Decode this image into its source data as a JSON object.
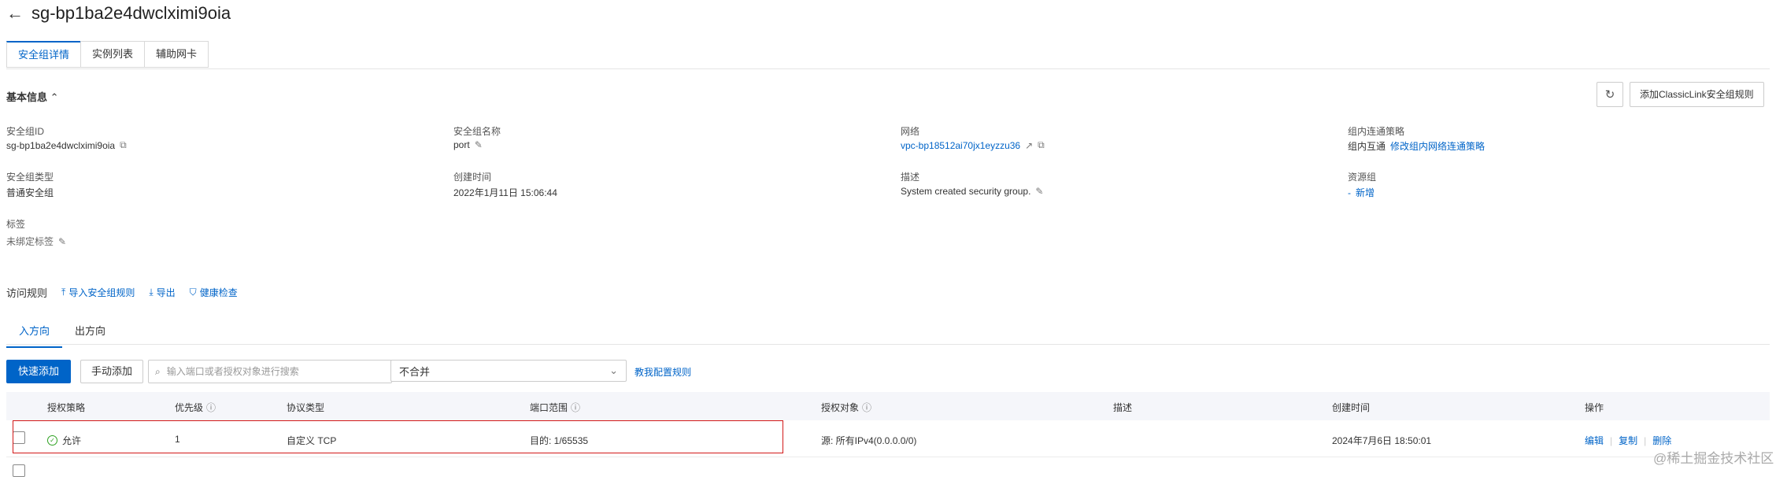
{
  "header": {
    "back_icon": "arrow-left-icon",
    "title": "sg-bp1ba2e4dwclximi9oia"
  },
  "top_tabs": [
    "安全组详情",
    "实例列表",
    "辅助网卡"
  ],
  "basic_info": {
    "title": "基本信息",
    "classic_link_button": "添加ClassicLink安全组规则",
    "fields": {
      "sg_id": {
        "label": "安全组ID",
        "value": "sg-bp1ba2e4dwclximi9oia"
      },
      "sg_name": {
        "label": "安全组名称",
        "value": "port"
      },
      "network": {
        "label": "网络",
        "value": "vpc-bp18512ai70jx1eyzzu36"
      },
      "intra_policy": {
        "label": "组内连通策略",
        "value": "组内互通",
        "link": "修改组内网络连通策略"
      },
      "sg_type": {
        "label": "安全组类型",
        "value": "普通安全组"
      },
      "created": {
        "label": "创建时间",
        "value": "2022年1月11日 15:06:44"
      },
      "desc": {
        "label": "描述",
        "value": "System created security group."
      },
      "resource_group": {
        "label": "资源组",
        "dash": "-",
        "link": "新增"
      },
      "tags": {
        "label": "标签",
        "value": "未绑定标签"
      }
    }
  },
  "rules": {
    "title": "访问规则",
    "import": "导入安全组规则",
    "export": "导出",
    "health": "健康检查",
    "direction_tabs": [
      "入方向",
      "出方向"
    ],
    "quick_add": "快速添加",
    "manual_add": "手动添加",
    "search_placeholder": "输入端口或者授权对象进行搜索",
    "merge_select": "不合并",
    "tutorial_link": "教我配置规则",
    "columns": [
      "授权策略",
      "优先级",
      "协议类型",
      "端口范围",
      "授权对象",
      "描述",
      "创建时间",
      "操作"
    ],
    "row": {
      "policy": "允许",
      "priority": "1",
      "protocol": "自定义 TCP",
      "port": "目的: 1/65535",
      "object": "源: 所有IPv4(0.0.0.0/0)",
      "desc": "",
      "created": "2024年7月6日 18:50:01",
      "ops": [
        "编辑",
        "复制",
        "删除"
      ]
    }
  },
  "watermark": "@稀土掘金技术社区"
}
